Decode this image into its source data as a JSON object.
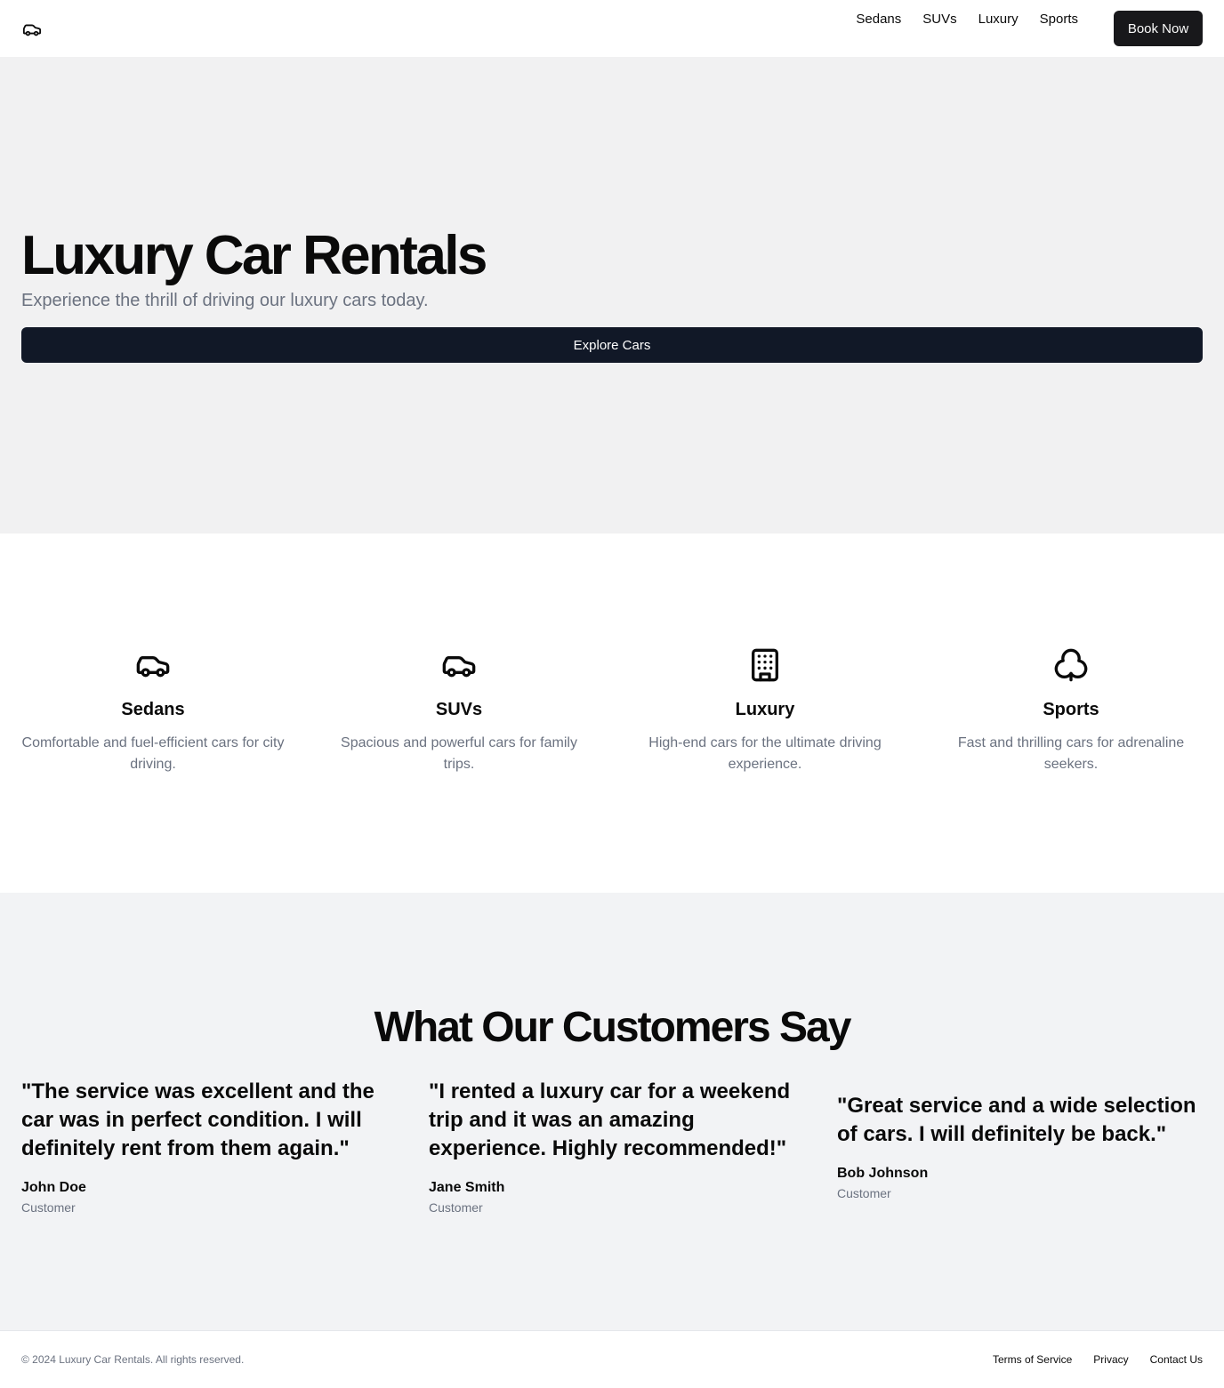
{
  "header": {
    "logo_icon": "car-icon",
    "nav": [
      {
        "label": "Sedans"
      },
      {
        "label": "SUVs"
      },
      {
        "label": "Luxury"
      },
      {
        "label": "Sports"
      }
    ],
    "book_button": "Book Now"
  },
  "hero": {
    "title": "Luxury Car Rentals",
    "subtitle": "Experience the thrill of driving our luxury cars today.",
    "cta": "Explore Cars"
  },
  "categories": [
    {
      "icon": "car-icon",
      "name": "Sedans",
      "description": "Comfortable and fuel-efficient cars for city driving."
    },
    {
      "icon": "car-icon",
      "name": "SUVs",
      "description": "Spacious and powerful cars for family trips."
    },
    {
      "icon": "building-icon",
      "name": "Luxury",
      "description": "High-end cars for the ultimate driving experience."
    },
    {
      "icon": "club-icon",
      "name": "Sports",
      "description": "Fast and thrilling cars for adrenaline seekers."
    }
  ],
  "testimonials": {
    "title": "What Our Customers Say",
    "items": [
      {
        "quote": "\"The service was excellent and the car was in perfect condition. I will definitely rent from them again.\"",
        "author": "John Doe",
        "role": "Customer"
      },
      {
        "quote": "\"I rented a luxury car for a weekend trip and it was an amazing experience. Highly recommended!\"",
        "author": "Jane Smith",
        "role": "Customer"
      },
      {
        "quote": "\"Great service and a wide selection of cars. I will definitely be back.\"",
        "author": "Bob Johnson",
        "role": "Customer"
      }
    ]
  },
  "footer": {
    "copyright": "© 2024 Luxury Car Rentals. All rights reserved.",
    "links": [
      {
        "label": "Terms of Service"
      },
      {
        "label": "Privacy"
      },
      {
        "label": "Contact Us"
      }
    ]
  },
  "colors": {
    "primary_button": "#111827",
    "header_button": "#18181b",
    "muted_text": "#6b7280",
    "hero_bg": "#f1f1f2",
    "testimonials_bg": "#f2f3f5"
  }
}
